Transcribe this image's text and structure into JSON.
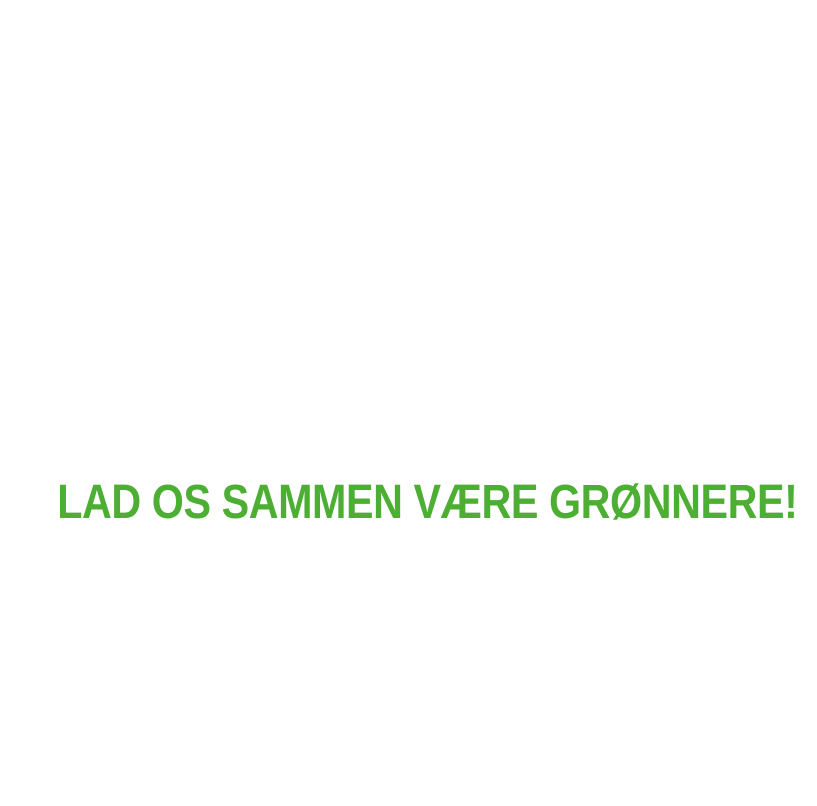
{
  "main": {
    "headline": "LAD OS SAMMEN VÆRE GRØNNERE!"
  },
  "colors": {
    "background": "#ffffff",
    "headline": "#4caf33"
  }
}
